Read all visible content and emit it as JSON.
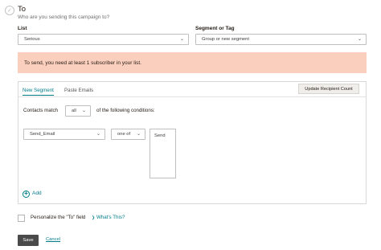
{
  "header": {
    "check_glyph": "✓",
    "title": "To",
    "subtitle": "Who are you sending this campaign to?"
  },
  "list": {
    "label": "List",
    "value": "Serious"
  },
  "segment": {
    "label": "Segment or Tag",
    "value": "Group or new segment"
  },
  "alert": {
    "text": "To send, you need at least 1 subscriber in your list."
  },
  "segment_panel": {
    "tabs": [
      {
        "label": "New Segment",
        "active": true
      },
      {
        "label": "Paste Emails",
        "active": false
      }
    ],
    "update_button": "Update Recipient Count",
    "contacts_match_label": "Contacts match",
    "match_value": "all",
    "conditions_label": "of the following conditions:",
    "condition": {
      "field": "Send_Email",
      "operator": "one of",
      "values": [
        "Send"
      ]
    },
    "add_label": "Add",
    "add_glyph": "+"
  },
  "personalize": {
    "label": "Personalize the \"To\" field",
    "help_link": "What's This?",
    "help_glyph": "❯"
  },
  "footer": {
    "save": "Save",
    "cancel": "Cancel"
  },
  "chevron_glyph": "⌄",
  "colors": {
    "accent": "#007c89",
    "alert_bg": "#fbcfbd",
    "save_bg": "#4a4a4a"
  }
}
